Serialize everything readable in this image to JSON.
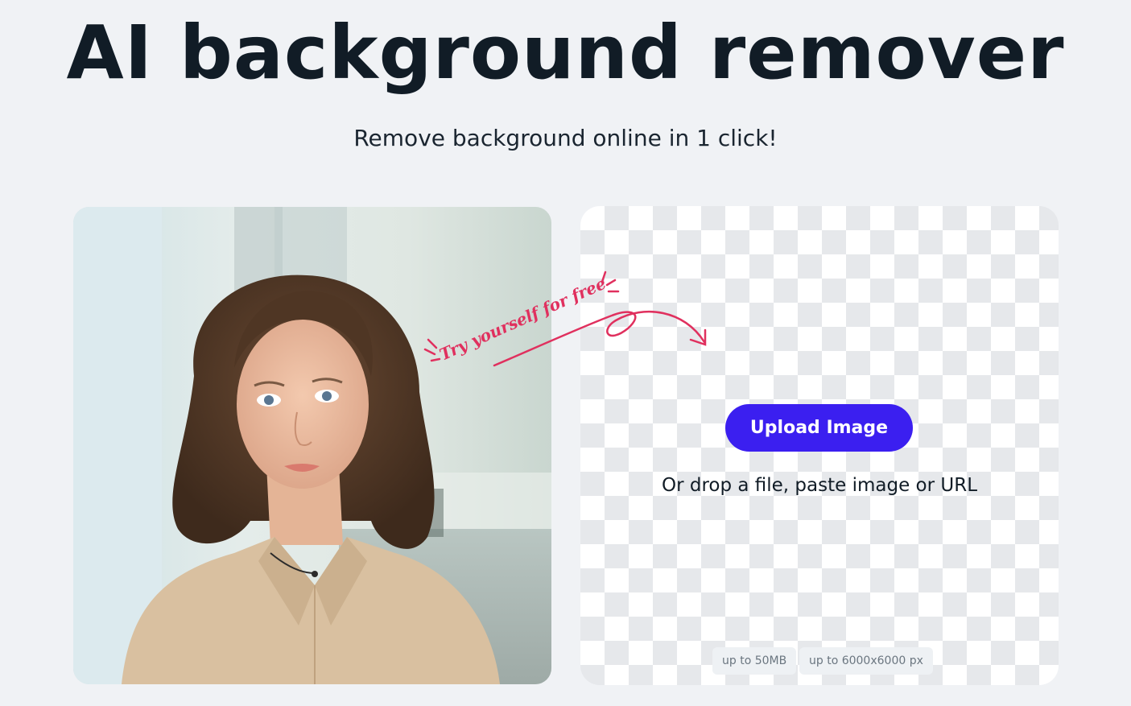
{
  "hero": {
    "title": "AI background remover",
    "subtitle": "Remove background online in 1 click!"
  },
  "callout": {
    "text": "Try yourself for free",
    "color": "#e0305e"
  },
  "upload": {
    "button_label": "Upload Image",
    "drop_hint": "Or drop a file, paste image or URL",
    "limits": {
      "size": "up to 50MB",
      "dimensions": "up to 6000x6000 px"
    }
  },
  "colors": {
    "background": "#f0f2f5",
    "accent": "#3b1ff0",
    "title_text": "#111c26"
  }
}
